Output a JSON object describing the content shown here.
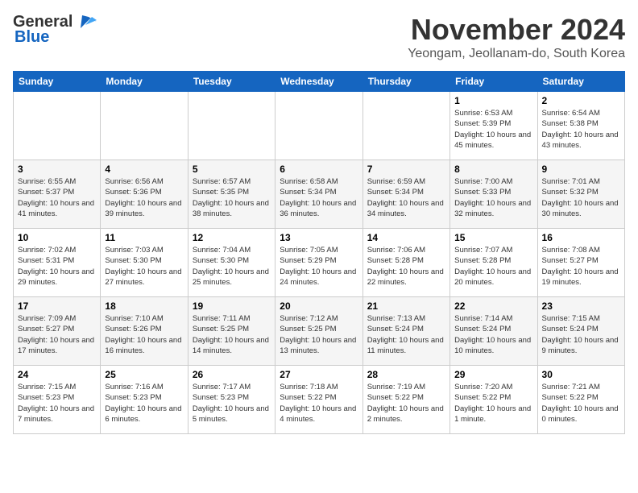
{
  "header": {
    "logo_line1": "General",
    "logo_line2": "Blue",
    "month_title": "November 2024",
    "location": "Yeongam, Jeollanam-do, South Korea"
  },
  "days_of_week": [
    "Sunday",
    "Monday",
    "Tuesday",
    "Wednesday",
    "Thursday",
    "Friday",
    "Saturday"
  ],
  "weeks": [
    [
      {
        "day": "",
        "info": ""
      },
      {
        "day": "",
        "info": ""
      },
      {
        "day": "",
        "info": ""
      },
      {
        "day": "",
        "info": ""
      },
      {
        "day": "",
        "info": ""
      },
      {
        "day": "1",
        "info": "Sunrise: 6:53 AM\nSunset: 5:39 PM\nDaylight: 10 hours and 45 minutes."
      },
      {
        "day": "2",
        "info": "Sunrise: 6:54 AM\nSunset: 5:38 PM\nDaylight: 10 hours and 43 minutes."
      }
    ],
    [
      {
        "day": "3",
        "info": "Sunrise: 6:55 AM\nSunset: 5:37 PM\nDaylight: 10 hours and 41 minutes."
      },
      {
        "day": "4",
        "info": "Sunrise: 6:56 AM\nSunset: 5:36 PM\nDaylight: 10 hours and 39 minutes."
      },
      {
        "day": "5",
        "info": "Sunrise: 6:57 AM\nSunset: 5:35 PM\nDaylight: 10 hours and 38 minutes."
      },
      {
        "day": "6",
        "info": "Sunrise: 6:58 AM\nSunset: 5:34 PM\nDaylight: 10 hours and 36 minutes."
      },
      {
        "day": "7",
        "info": "Sunrise: 6:59 AM\nSunset: 5:34 PM\nDaylight: 10 hours and 34 minutes."
      },
      {
        "day": "8",
        "info": "Sunrise: 7:00 AM\nSunset: 5:33 PM\nDaylight: 10 hours and 32 minutes."
      },
      {
        "day": "9",
        "info": "Sunrise: 7:01 AM\nSunset: 5:32 PM\nDaylight: 10 hours and 30 minutes."
      }
    ],
    [
      {
        "day": "10",
        "info": "Sunrise: 7:02 AM\nSunset: 5:31 PM\nDaylight: 10 hours and 29 minutes."
      },
      {
        "day": "11",
        "info": "Sunrise: 7:03 AM\nSunset: 5:30 PM\nDaylight: 10 hours and 27 minutes."
      },
      {
        "day": "12",
        "info": "Sunrise: 7:04 AM\nSunset: 5:30 PM\nDaylight: 10 hours and 25 minutes."
      },
      {
        "day": "13",
        "info": "Sunrise: 7:05 AM\nSunset: 5:29 PM\nDaylight: 10 hours and 24 minutes."
      },
      {
        "day": "14",
        "info": "Sunrise: 7:06 AM\nSunset: 5:28 PM\nDaylight: 10 hours and 22 minutes."
      },
      {
        "day": "15",
        "info": "Sunrise: 7:07 AM\nSunset: 5:28 PM\nDaylight: 10 hours and 20 minutes."
      },
      {
        "day": "16",
        "info": "Sunrise: 7:08 AM\nSunset: 5:27 PM\nDaylight: 10 hours and 19 minutes."
      }
    ],
    [
      {
        "day": "17",
        "info": "Sunrise: 7:09 AM\nSunset: 5:27 PM\nDaylight: 10 hours and 17 minutes."
      },
      {
        "day": "18",
        "info": "Sunrise: 7:10 AM\nSunset: 5:26 PM\nDaylight: 10 hours and 16 minutes."
      },
      {
        "day": "19",
        "info": "Sunrise: 7:11 AM\nSunset: 5:25 PM\nDaylight: 10 hours and 14 minutes."
      },
      {
        "day": "20",
        "info": "Sunrise: 7:12 AM\nSunset: 5:25 PM\nDaylight: 10 hours and 13 minutes."
      },
      {
        "day": "21",
        "info": "Sunrise: 7:13 AM\nSunset: 5:24 PM\nDaylight: 10 hours and 11 minutes."
      },
      {
        "day": "22",
        "info": "Sunrise: 7:14 AM\nSunset: 5:24 PM\nDaylight: 10 hours and 10 minutes."
      },
      {
        "day": "23",
        "info": "Sunrise: 7:15 AM\nSunset: 5:24 PM\nDaylight: 10 hours and 9 minutes."
      }
    ],
    [
      {
        "day": "24",
        "info": "Sunrise: 7:15 AM\nSunset: 5:23 PM\nDaylight: 10 hours and 7 minutes."
      },
      {
        "day": "25",
        "info": "Sunrise: 7:16 AM\nSunset: 5:23 PM\nDaylight: 10 hours and 6 minutes."
      },
      {
        "day": "26",
        "info": "Sunrise: 7:17 AM\nSunset: 5:23 PM\nDaylight: 10 hours and 5 minutes."
      },
      {
        "day": "27",
        "info": "Sunrise: 7:18 AM\nSunset: 5:22 PM\nDaylight: 10 hours and 4 minutes."
      },
      {
        "day": "28",
        "info": "Sunrise: 7:19 AM\nSunset: 5:22 PM\nDaylight: 10 hours and 2 minutes."
      },
      {
        "day": "29",
        "info": "Sunrise: 7:20 AM\nSunset: 5:22 PM\nDaylight: 10 hours and 1 minute."
      },
      {
        "day": "30",
        "info": "Sunrise: 7:21 AM\nSunset: 5:22 PM\nDaylight: 10 hours and 0 minutes."
      }
    ]
  ]
}
